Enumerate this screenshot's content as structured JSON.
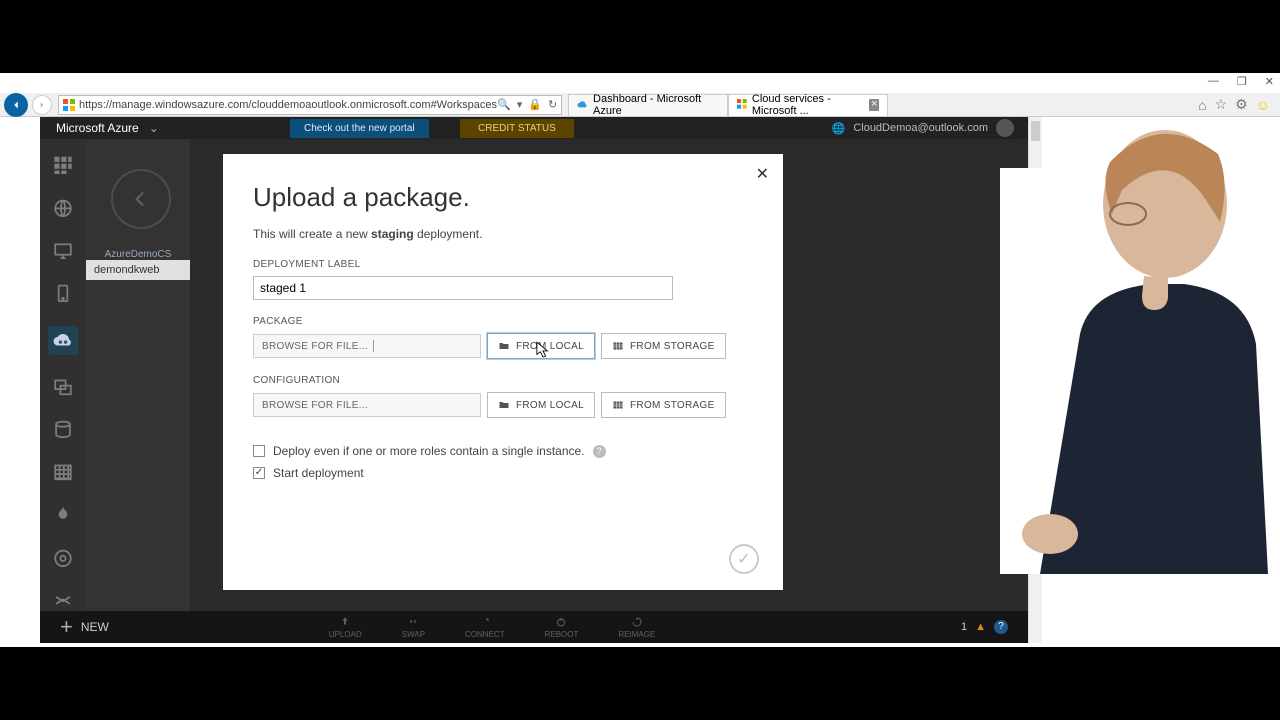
{
  "window": {
    "minimize": "—",
    "maximize": "❐",
    "close": "✕"
  },
  "browser": {
    "url": "https://manage.windowsazure.com/clouddemoaoutlook.onmicrosoft.com#Workspaces",
    "tabs": [
      {
        "label": "Dashboard - Microsoft Azure",
        "active": false
      },
      {
        "label": "Cloud services - Microsoft ...",
        "active": true
      }
    ]
  },
  "portal": {
    "brand": "Microsoft Azure",
    "new_portal_link": "Check out the new portal",
    "credit_status": "CREDIT STATUS",
    "user_email": "CloudDemoa@outlook.com",
    "subnav": {
      "service_name": "AzureDemoCS",
      "selected_item": "demondkweb"
    },
    "bottom": {
      "new_label": "NEW",
      "actions": [
        "UPLOAD",
        "SWAP",
        "CONNECT",
        "REBOOT",
        "REIMAGE"
      ],
      "alert_count": "1"
    }
  },
  "modal": {
    "title": "Upload a package.",
    "subtitle_pre": "This will create a new ",
    "subtitle_bold": "staging",
    "subtitle_post": " deployment.",
    "label_deployment": "DEPLOYMENT LABEL",
    "value_deployment": "staged 1",
    "label_package": "PACKAGE",
    "label_configuration": "CONFIGURATION",
    "browse_placeholder": "BROWSE FOR FILE...",
    "btn_from_local": "FROM LOCAL",
    "btn_from_storage": "FROM STORAGE",
    "chk_deploy_single": "Deploy even if one or more roles contain a single instance.",
    "chk_start_deploy": "Start deployment"
  }
}
